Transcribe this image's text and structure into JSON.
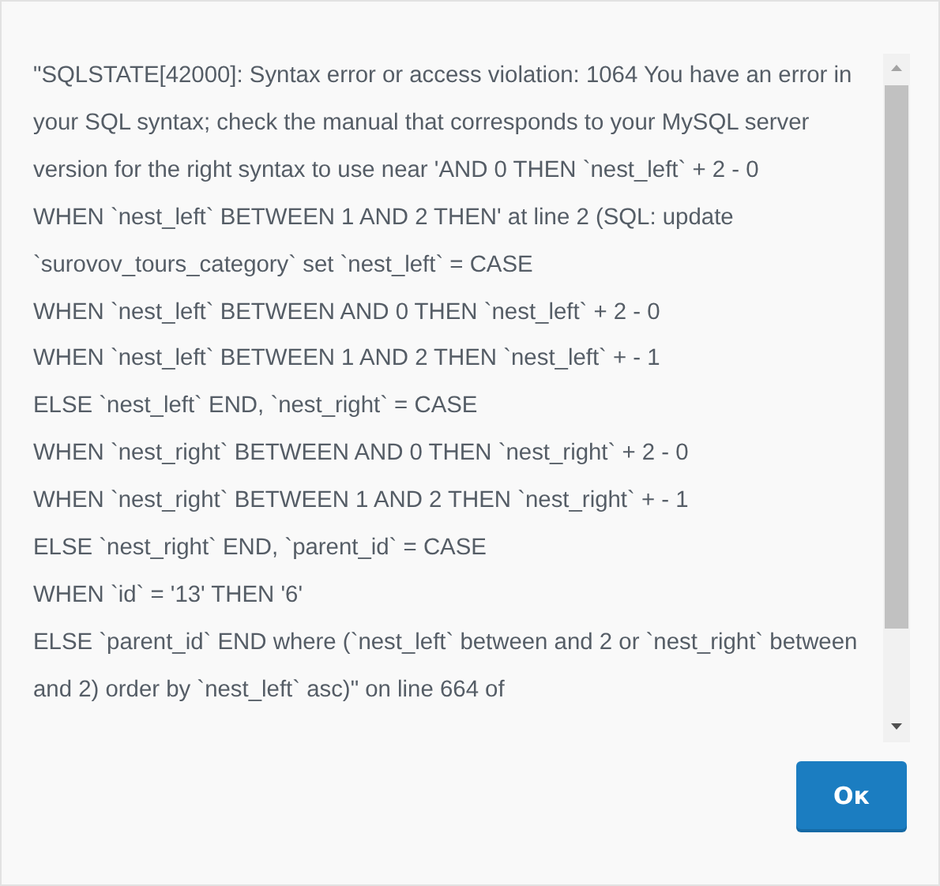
{
  "dialog": {
    "message": "\"SQLSTATE[42000]: Syntax error or access violation: 1064 You have an error in your SQL syntax; check the manual that corresponds to your MySQL server version for the right syntax to use near 'AND 0 THEN `nest_left` + 2 - 0\nWHEN `nest_left` BETWEEN 1 AND 2 THEN' at line 2 (SQL: update `surovov_tours_category` set `nest_left` = CASE\nWHEN `nest_left` BETWEEN AND 0 THEN `nest_left` + 2 - 0\nWHEN `nest_left` BETWEEN 1 AND 2 THEN `nest_left` + - 1\nELSE `nest_left` END, `nest_right` = CASE\nWHEN `nest_right` BETWEEN AND 0 THEN `nest_right` + 2 - 0\nWHEN `nest_right` BETWEEN 1 AND 2 THEN `nest_right` + - 1\nELSE `nest_right` END, `parent_id` = CASE\nWHEN `id` = '13' THEN '6'\nELSE `parent_id` END where (`nest_left` between and 2 or `nest_right` between and 2) order by `nest_left` asc)\" on line 664 of",
    "button": "Ок"
  }
}
